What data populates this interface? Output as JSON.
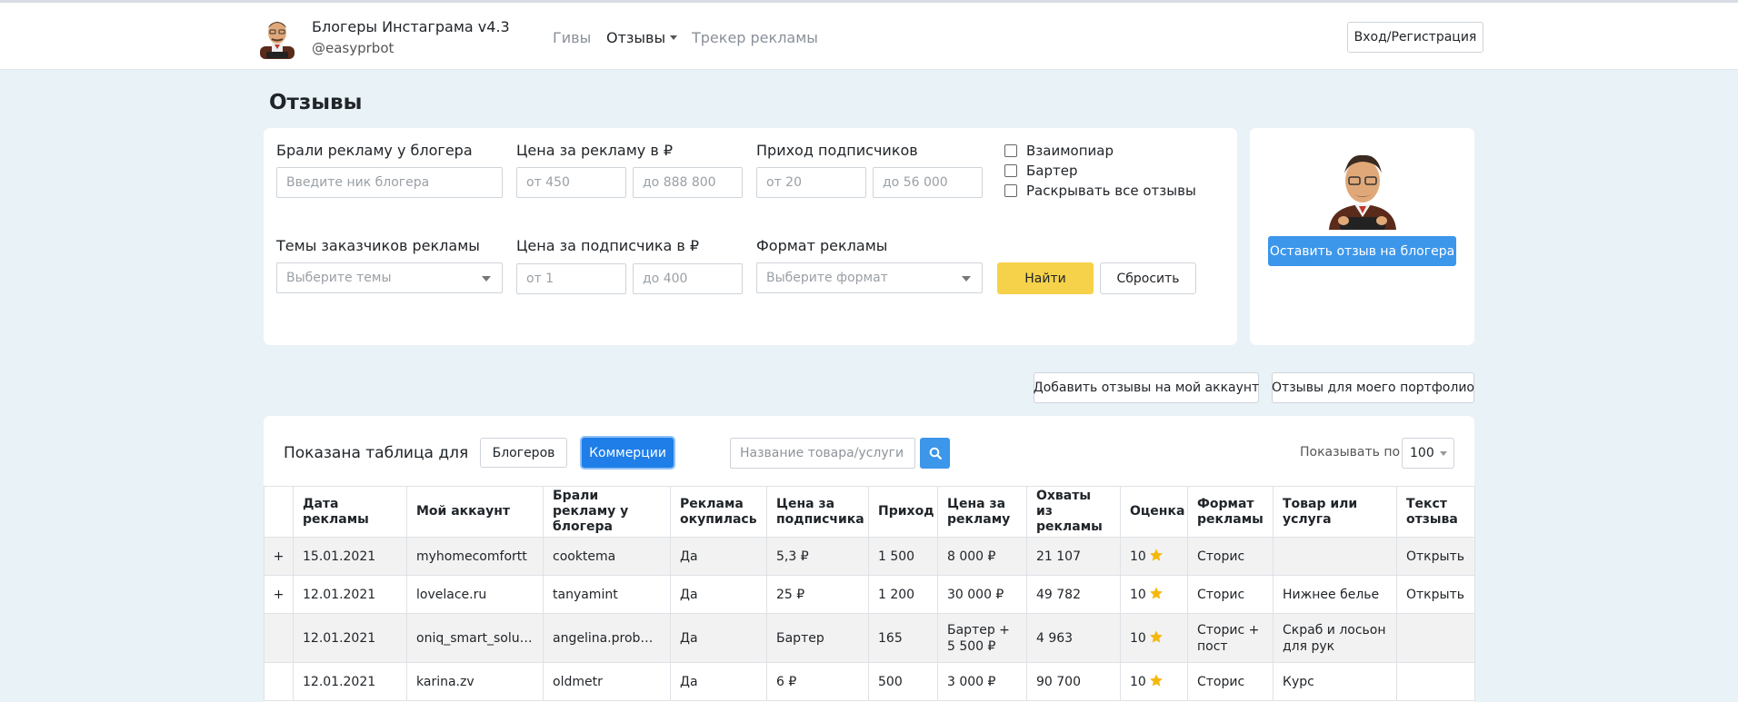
{
  "header": {
    "title": "Блогеры Инстаграма v4.3",
    "subtitle": "@easyprbot",
    "nav": [
      {
        "label": "Гивы",
        "active": false
      },
      {
        "label": "Отзывы",
        "active": true,
        "dropdown": true
      },
      {
        "label": "Трекер рекламы",
        "active": false
      }
    ],
    "login_label": "Вход/Регистрация"
  },
  "page_title": "Отзывы",
  "filters": {
    "blogger_label": "Брали рекламу у блогера",
    "blogger_placeholder": "Введите ник блогера",
    "price_label": "Цена за рекламу в ₽",
    "price_from_placeholder": "от 450",
    "price_to_placeholder": "до 888 800",
    "subs_label": "Приход подписчиков",
    "subs_from_placeholder": "от 20",
    "subs_to_placeholder": "до 56 000",
    "checkbox_mutual": "Взаимопиар",
    "checkbox_barter": "Бартер",
    "checkbox_expand": "Раскрывать все отзывы",
    "themes_label": "Темы заказчиков рекламы",
    "themes_placeholder": "Выберите темы",
    "sub_price_label": "Цена за подписчика в ₽",
    "sub_price_from_placeholder": "от 1",
    "sub_price_to_placeholder": "до 400",
    "format_label": "Формат рекламы",
    "format_placeholder": "Выберите формат",
    "find_label": "Найти",
    "reset_label": "Сбросить"
  },
  "side_card": {
    "leave_review_label": "Оставить отзыв на блогера"
  },
  "actions": {
    "add_reviews_label": "Добавить отзывы на мой аккаунт",
    "portfolio_label": "Отзывы для моего портфолио"
  },
  "table_controls": {
    "shown_for_label": "Показана таблица для",
    "bloggers_label": "Блогеров",
    "commerce_label": "Коммерции",
    "product_placeholder": "Название товара/услуги",
    "show_per_label": "Показывать по",
    "per_page_value": "100"
  },
  "table": {
    "columns": [
      "",
      "Дата рекламы",
      "Мой аккаунт",
      "Брали рекламу у блогера",
      "Реклама окупилась",
      "Цена за подписчика",
      "Приход",
      "Цена за рекламу",
      "Охваты из рекламы",
      "Оценка",
      "Формат рекламы",
      "Товар или услуга",
      "Текст отзыва"
    ],
    "rows": [
      {
        "expand": "+",
        "date": "15.01.2021",
        "account": "myhomecomfortt",
        "blogger": "cooktema",
        "paid_off": "Да",
        "sub_price": "5,3 ₽",
        "income": "1 500",
        "ad_price": "8 000 ₽",
        "reach": "21 107",
        "rating": "10",
        "format": "Сторис",
        "product": "",
        "review": "Открыть"
      },
      {
        "expand": "+",
        "date": "12.01.2021",
        "account": "lovelace.ru",
        "blogger": "tanyamint",
        "paid_off": "Да",
        "sub_price": "25 ₽",
        "income": "1 200",
        "ad_price": "30 000 ₽",
        "reach": "49 782",
        "rating": "10",
        "format": "Сторис",
        "product": "Нижнее белье",
        "review": "Открыть"
      },
      {
        "expand": "",
        "date": "12.01.2021",
        "account": "oniq_smart_solu…",
        "blogger": "angelina.probeauty",
        "paid_off": "Да",
        "sub_price": "Бартер",
        "income": "165",
        "ad_price": "Бартер + 5 500 ₽",
        "reach": "4 963",
        "rating": "10",
        "format": "Сторис + пост",
        "product": "Скраб и лосьон для рук",
        "review": ""
      },
      {
        "expand": "",
        "date": "12.01.2021",
        "account": "karina.zv",
        "blogger": "oldmetr",
        "paid_off": "Да",
        "sub_price": "6 ₽",
        "income": "500",
        "ad_price": "3 000 ₽",
        "reach": "90 700",
        "rating": "10",
        "format": "Сторис",
        "product": "Курс",
        "review": ""
      }
    ]
  }
}
